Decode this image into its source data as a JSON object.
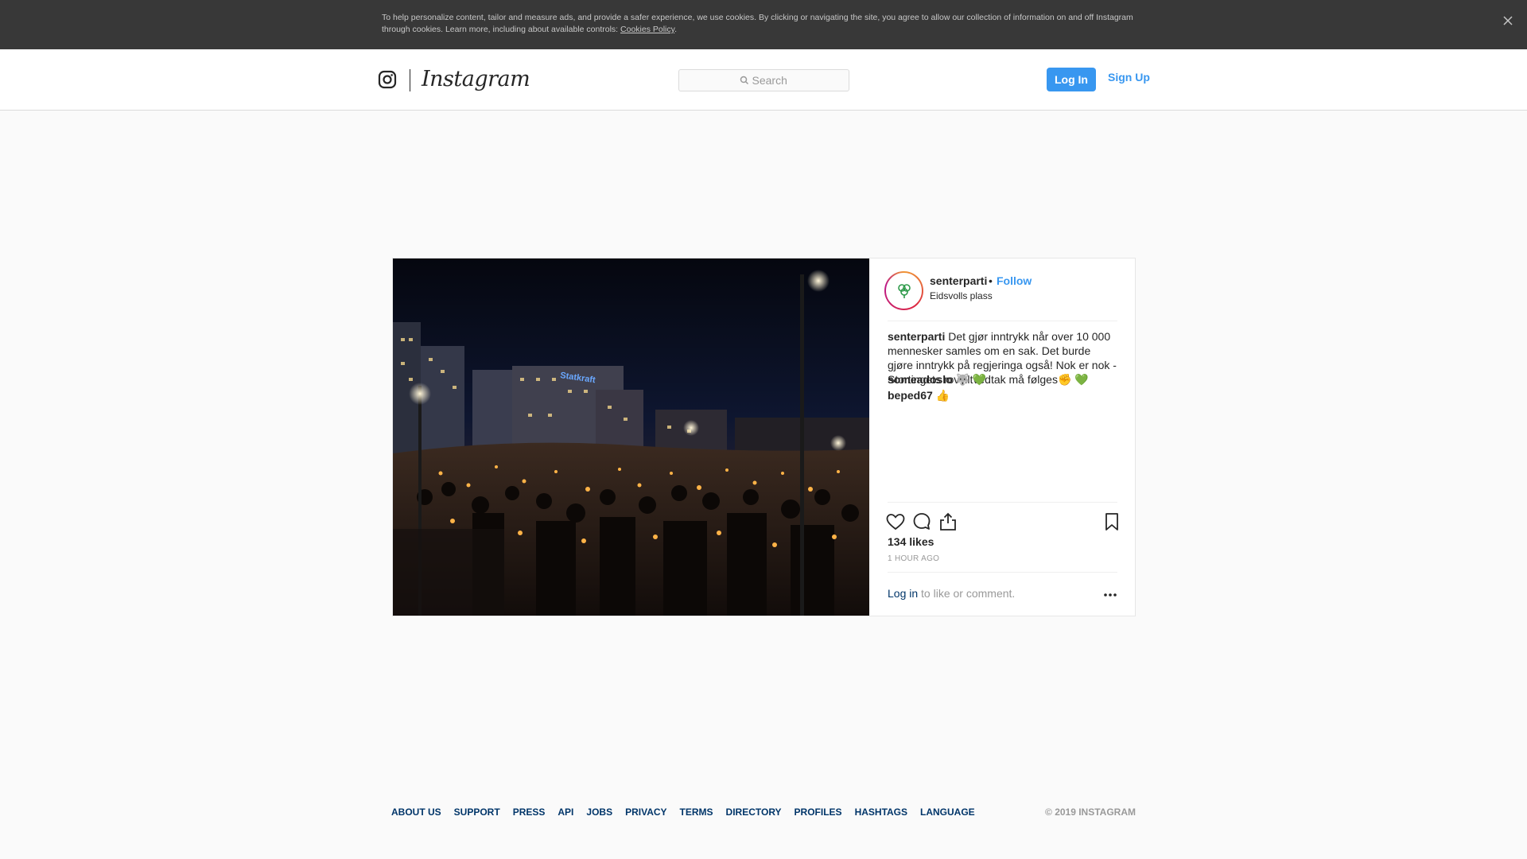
{
  "cookie_banner": {
    "text": "To help personalize content, tailor and measure ads, and provide a safer experience, we use cookies. By clicking or navigating the site, you agree to allow our collection of information on and off Instagram through cookies. Learn more, including about available controls: ",
    "link_label": "Cookies Policy",
    "trailing": "."
  },
  "header": {
    "wordmark": "Instagram",
    "search_placeholder": "Search",
    "login_label": "Log In",
    "signup_label": "Sign Up"
  },
  "post": {
    "username": "senterparti",
    "dot": "•",
    "follow_label": "Follow",
    "location": "Eidsvolls plass",
    "caption_user": "senterparti",
    "caption_text": " Det gjør inntrykk når over 10 000 mennesker samles om en sak. Det burde gjøre inntrykk på regjeringa også! Nok er nok - Stortingets rovviltvedtak må følges✊ 💚",
    "comments": [
      {
        "text": "someadoslo 🐺 💚"
      },
      {
        "text": "beped67 👍"
      }
    ],
    "likes": "134 likes",
    "time": "1 HOUR AGO",
    "login_link": "Log in",
    "login_rest": " to like or comment."
  },
  "footer": {
    "links": [
      "ABOUT US",
      "SUPPORT",
      "PRESS",
      "API",
      "JOBS",
      "PRIVACY",
      "TERMS",
      "DIRECTORY",
      "PROFILES",
      "HASHTAGS",
      "LANGUAGE"
    ],
    "copyright": "© 2019 INSTAGRAM"
  },
  "colors": {
    "accent": "#3897f0",
    "link_dark": "#003569",
    "banner_bg": "#383838"
  }
}
